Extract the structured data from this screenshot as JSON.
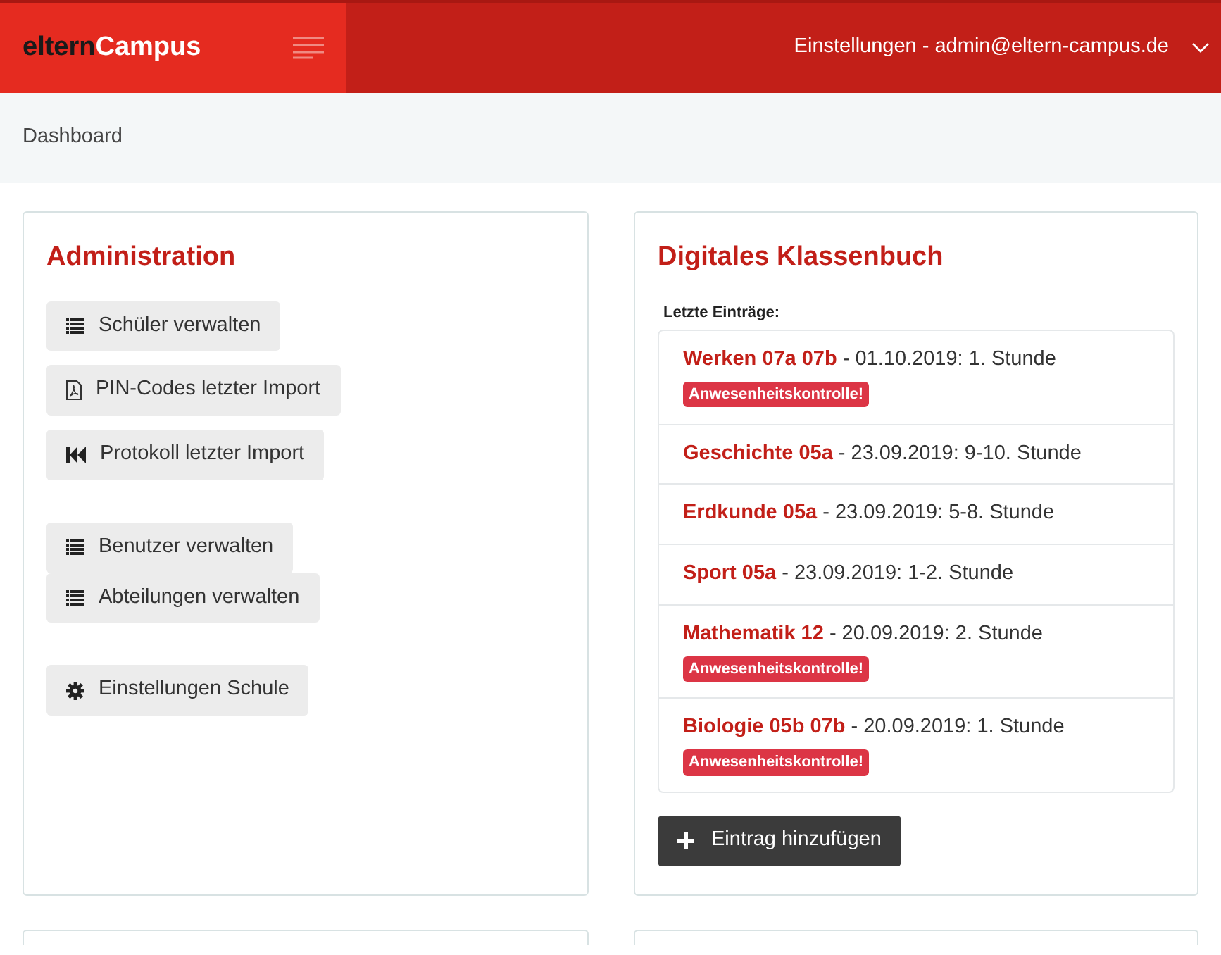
{
  "brand": {
    "part_1": "eltern",
    "part_2": "Campus"
  },
  "user_menu": {
    "label": "Einstellungen - admin@eltern-campus.de"
  },
  "breadcrumb": "Dashboard",
  "administration": {
    "title": "Administration",
    "groups": [
      [
        {
          "label": "Schüler verwalten",
          "kind": "list"
        },
        {
          "label": "PIN-Codes letzter Import",
          "kind": "pdf"
        },
        {
          "label": "Protokoll letzter Import",
          "kind": "rewind"
        }
      ],
      [
        {
          "label": "Benutzer verwalten",
          "kind": "list"
        },
        {
          "label": "Abteilungen verwalten",
          "kind": "list"
        }
      ],
      [
        {
          "label": "Einstellungen Schule",
          "kind": "gear"
        }
      ]
    ]
  },
  "klassenbuch": {
    "title": "Digitales Klassenbuch",
    "subtitle": "Letzte Einträge:",
    "entries": [
      {
        "course": "Werken 07a 07b",
        "detail": "- 01.10.2019: 1. Stunde",
        "badge": "Anwesenheitskontrolle!"
      },
      {
        "course": "Geschichte 05a",
        "detail": "- 23.09.2019: 9-10. Stunde"
      },
      {
        "course": "Erdkunde 05a",
        "detail": "- 23.09.2019: 5-8. Stunde"
      },
      {
        "course": "Sport 05a",
        "detail": "- 23.09.2019: 1-2. Stunde"
      },
      {
        "course": "Mathematik 12",
        "detail": "- 20.09.2019: 2. Stunde",
        "badge": "Anwesenheitskontrolle!"
      },
      {
        "course": "Biologie 05b 07b",
        "detail": "- 20.09.2019: 1. Stunde",
        "badge": "Anwesenheitskontrolle!"
      }
    ],
    "add_button": "Eintrag hinzufügen"
  }
}
